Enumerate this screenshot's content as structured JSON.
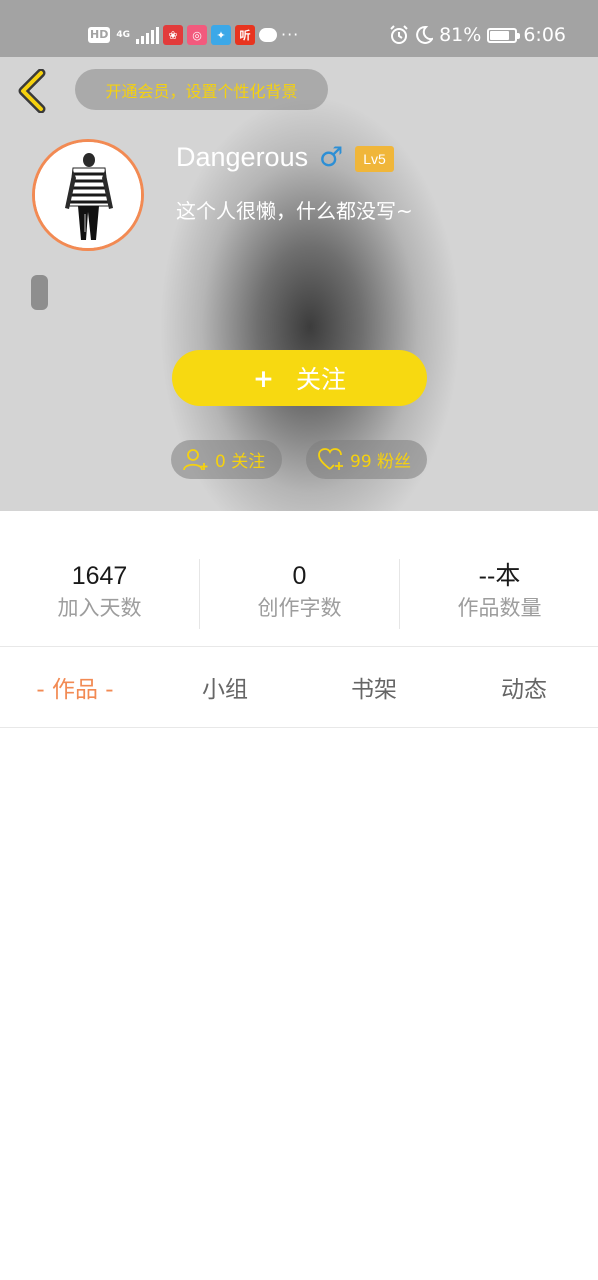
{
  "status_bar": {
    "left_badge": "HD",
    "network": "4G",
    "app_icon_4": "听",
    "battery": "81%",
    "battery_level": 0.81,
    "time": "6:06"
  },
  "header": {
    "vip_promo": "开通会员，设置个性化背景",
    "username": "Dangerous",
    "gender_symbol": "♂",
    "level": "Lv5",
    "bio": "这个人很懒，什么都没写~",
    "follow_label": "关注",
    "follow_plus": "+",
    "following_text": "0 关注",
    "fans_text": "99 粉丝"
  },
  "stats": [
    {
      "value": "1647",
      "label": "加入天数"
    },
    {
      "value": "0",
      "label": "创作字数"
    },
    {
      "value": "--本",
      "label": "作品数量"
    }
  ],
  "tabs": [
    {
      "label": "- 作品 -",
      "active": true
    },
    {
      "label": "小组",
      "active": false
    },
    {
      "label": "书架",
      "active": false
    },
    {
      "label": "动态",
      "active": false
    }
  ],
  "colors": {
    "accent_yellow": "#f7d911",
    "accent_orange": "#f28a53",
    "gender_blue": "#2d8fd5",
    "level_badge": "#f0b63a"
  }
}
